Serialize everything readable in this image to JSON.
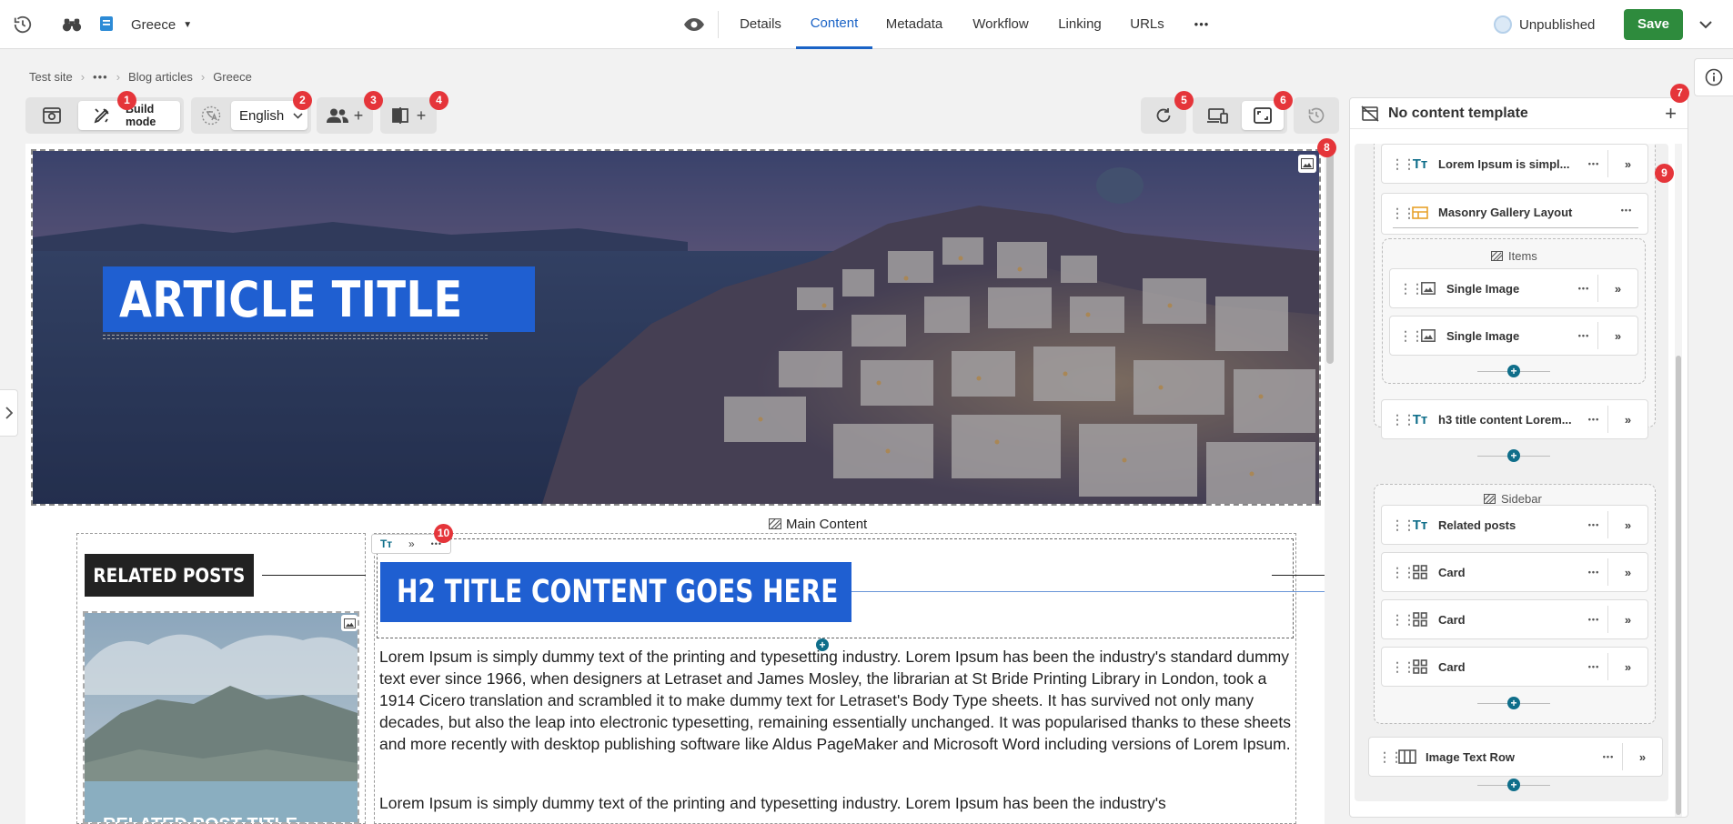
{
  "topbar": {
    "site_name": "Greece",
    "tabs": [
      {
        "label": "Details"
      },
      {
        "label": "Content"
      },
      {
        "label": "Metadata"
      },
      {
        "label": "Workflow"
      },
      {
        "label": "Linking"
      },
      {
        "label": "URLs"
      }
    ],
    "more_label": "•••",
    "status": "Unpublished",
    "save_label": "Save"
  },
  "breadcrumb": {
    "items": [
      "Test site",
      "•••",
      "Blog articles",
      "Greece"
    ]
  },
  "toolbar": {
    "build_mode_label": "Build mode",
    "language": "English",
    "add_label": "+"
  },
  "badges": [
    "1",
    "2",
    "3",
    "4",
    "5",
    "6",
    "7",
    "8",
    "9",
    "10"
  ],
  "canvas": {
    "hero_title": "ARTICLE TITLE",
    "main_content_label": "Main Content",
    "related_posts_heading": "RELATED POSTS",
    "related_post_title_fragment": "RELATED POST TITLE",
    "h2_title": "H2 TITLE CONTENT GOES HERE",
    "paragraph_1": "Lorem Ipsum is simply dummy text of the printing and typesetting industry. Lorem Ipsum has been the industry's standard dummy text ever since 1966, when designers at Letraset and James Mosley, the librarian at St Bride Printing Library in London, took a 1914 Cicero translation and scrambled it to make dummy text for Letraset's Body Type sheets. It has survived not only many decades, but also the leap into electronic typesetting, remaining essentially unchanged. It was popularised thanks to these sheets and more recently with desktop publishing software like Aldus PageMaker and Microsoft Word including versions of Lorem Ipsum.",
    "paragraph_2": "Lorem Ipsum is simply dummy text of the printing and typesetting industry. Lorem Ipsum has been the industry's"
  },
  "panel": {
    "template_label": "No content template",
    "add_label": "+",
    "items": [
      {
        "label": "Lorem Ipsum is simpl...",
        "icon": "text-icon"
      },
      {
        "label": "Masonry Gallery Layout",
        "icon": "layout-icon"
      },
      {
        "label": "Single Image",
        "icon": "image-icon"
      },
      {
        "label": "Single Image",
        "icon": "image-icon"
      },
      {
        "label": "h3 title content Lorem...",
        "icon": "text-icon"
      },
      {
        "label": "Related posts",
        "icon": "text-icon"
      },
      {
        "label": "Card",
        "icon": "grid-icon"
      },
      {
        "label": "Card",
        "icon": "grid-icon"
      },
      {
        "label": "Card",
        "icon": "grid-icon"
      },
      {
        "label": "Image Text Row",
        "icon": "columns-icon"
      }
    ],
    "groups": {
      "items_label": "Items",
      "sidebar_label": "Sidebar"
    },
    "dots": "•••"
  },
  "colors": {
    "accent": "#1a63c6",
    "save_green": "#2e8b3d",
    "badge_red": "#e5353a",
    "title_blue": "#1f5fd1",
    "teal": "#0f6e8a"
  }
}
